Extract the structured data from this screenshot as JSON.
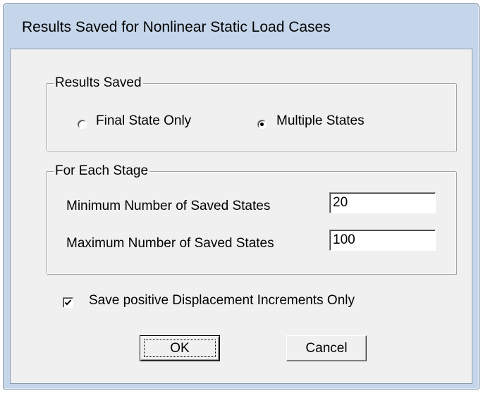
{
  "window": {
    "title": "Results Saved for Nonlinear Static Load Cases"
  },
  "results_saved": {
    "legend": "Results Saved",
    "options": [
      {
        "label": "Final State Only",
        "selected": false
      },
      {
        "label": "Multiple States",
        "selected": true
      }
    ]
  },
  "for_each_stage": {
    "legend": "For Each Stage",
    "min_label": "Minimum Number of Saved States",
    "min_value": "20",
    "max_label": "Maximum Number of Saved States",
    "max_value": "100"
  },
  "save_positive": {
    "label": "Save positive Displacement Increments Only",
    "checked": true
  },
  "buttons": {
    "ok": "OK",
    "cancel": "Cancel"
  },
  "colors": {
    "frame": "#c5d6ea",
    "client": "#f0f0f0"
  }
}
